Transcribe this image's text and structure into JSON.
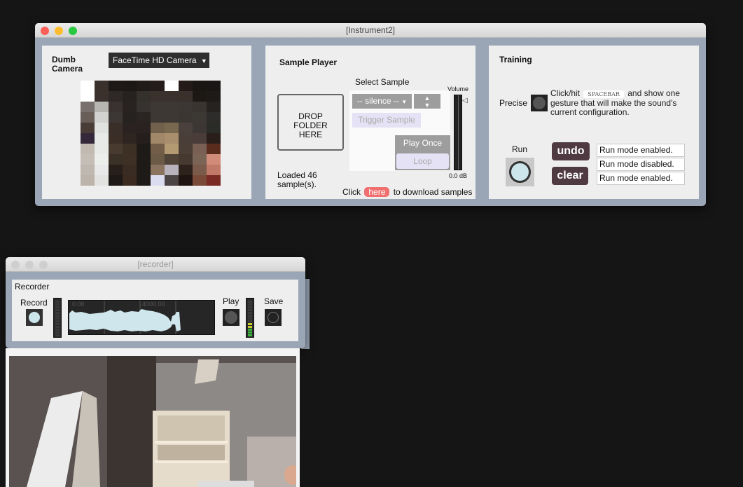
{
  "instrument_window": {
    "title": "[Instrument2]",
    "camera": {
      "label_line1": "Dumb",
      "label_line2": "Camera",
      "device_select": "FaceTime HD Camera"
    },
    "sample_player": {
      "title": "Sample Player",
      "select_label": "Select Sample",
      "sample_select": "-- silence --",
      "trigger_label": "Trigger Sample",
      "drop_line1": "DROP",
      "drop_line2": "FOLDER",
      "drop_line3": "HERE",
      "play_once_label": "Play Once",
      "loop_label": "Loop",
      "volume_label": "Volume",
      "volume_value": "0.0 dB",
      "loaded_line1": "Loaded 46",
      "loaded_line2": "sample(s).",
      "download_prefix": "Click",
      "download_link": "here",
      "download_suffix": "to download samples"
    },
    "training": {
      "title": "Training",
      "precise_label": "Precise",
      "instr_prefix": "Click/hit",
      "key": "SPACEBAR",
      "instr_suffix": "and show one",
      "instr_line2": "gesture that will make the sound's",
      "instr_line3": "current configuration.",
      "run_label": "Run",
      "undo_label": "undo",
      "clear_label": "clear",
      "log": [
        "Run mode enabled.",
        "Run mode disabled.",
        "Run mode enabled."
      ]
    }
  },
  "recorder_window": {
    "title": "[recorder]",
    "panel_title": "Recorder",
    "record_label": "Record",
    "play_label": "Play",
    "save_label": "Save",
    "waveform_ticks": [
      "0.00",
      "4000.00"
    ]
  },
  "colors": {
    "accent_link": "#f07070",
    "window_bg": "#9aa5b5",
    "dark_button": "#4e3a40",
    "waveform": "#cfe6ec"
  }
}
